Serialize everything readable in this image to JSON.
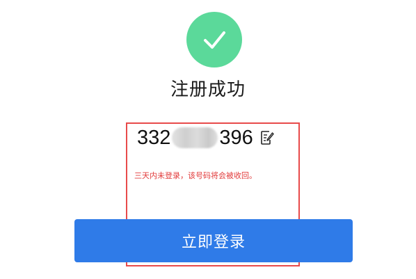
{
  "title": "注册成功",
  "account": {
    "prefix": "332",
    "suffix": "396"
  },
  "warning": "三天内未登录，该号码将会被收回。",
  "login_button_label": "立即登录",
  "icons": {
    "success": "checkmark-circle-icon",
    "edit": "edit-icon"
  },
  "colors": {
    "success": "#5bd99a",
    "primary": "#2f7be8",
    "warning": "#e23b3b",
    "highlight": "#e84a4a"
  }
}
